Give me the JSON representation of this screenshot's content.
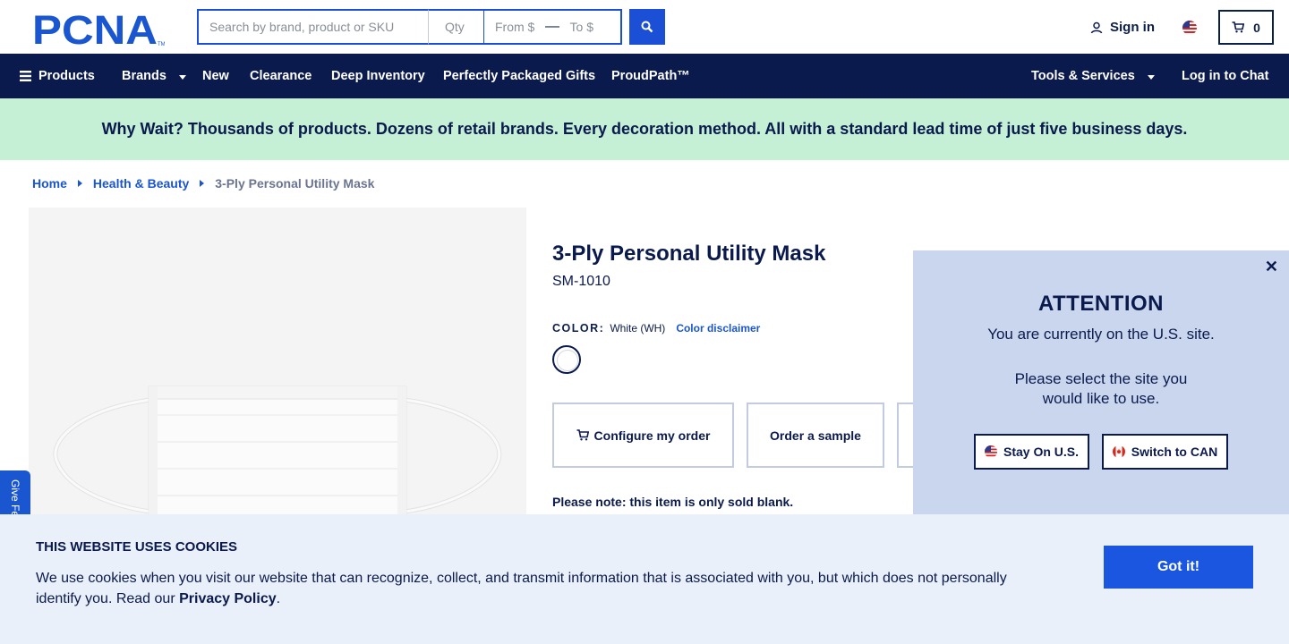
{
  "header": {
    "logo_text": "PCNA",
    "search_placeholder": "Search by brand, product or SKU",
    "qty_placeholder": "Qty",
    "from_placeholder": "From $",
    "to_placeholder": "To $",
    "signin_label": "Sign in",
    "cart_count": "0"
  },
  "nav": {
    "items": [
      "Products",
      "Brands",
      "New",
      "Clearance",
      "Deep Inventory",
      "Perfectly Packaged Gifts",
      "ProudPath™"
    ],
    "tools_label": "Tools & Services",
    "chat_label": "Log in to Chat"
  },
  "banner": {
    "text": "Why Wait? Thousands of products. Dozens of retail brands. Every decoration method. All with a standard lead time of just five business days."
  },
  "breadcrumb": [
    "Home",
    "Health & Beauty",
    "3-Ply Personal Utility Mask"
  ],
  "product": {
    "title": "3-Ply Personal Utility Mask",
    "sku": "SM-1010",
    "color_label": "COLOR:",
    "color_value": "White (WH)",
    "color_disclaimer": "Color disclaimer",
    "configure_label": "Configure my order",
    "sample_label": "Order a sample",
    "note": "Please note: this item is only sold blank."
  },
  "feedback": {
    "label": "Give Feedback"
  },
  "attention": {
    "title": "ATTENTION",
    "line1": "You are currently on the U.S. site.",
    "line2": "Please select the site you would like to use.",
    "stay_label": "Stay On U.S.",
    "switch_label": "Switch to CAN"
  },
  "cookie": {
    "title": "THIS WEBSITE USES COOKIES",
    "text_before": "We use cookies when you visit our website that can recognize, collect, and transmit information that is associated with you, but which does not personally identify you. Read our ",
    "link": "Privacy Policy",
    "text_after": ".",
    "button": "Got it!"
  },
  "colors": {
    "navy": "#0b1a4d",
    "brand_blue": "#1a56d0",
    "banner_green": "#c5f0d5",
    "popup_bg": "#c9d6ee",
    "cookie_bg": "#e9f0f9"
  }
}
